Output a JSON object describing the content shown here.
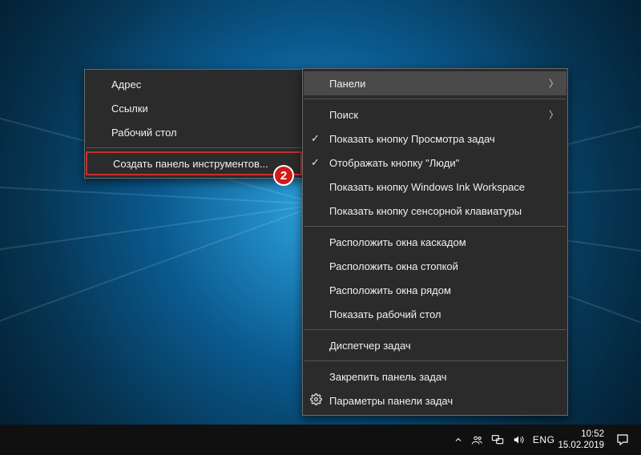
{
  "main_menu": {
    "items": {
      "toolbars": "Панели",
      "search": "Поиск",
      "show_task_view": "Показать кнопку Просмотра задач",
      "show_people": "Отображать кнопку \"Люди\"",
      "show_ink": "Показать кнопку Windows Ink Workspace",
      "show_touch_kb": "Показать кнопку сенсорной клавиатуры",
      "cascade": "Расположить окна каскадом",
      "stacked": "Расположить окна стопкой",
      "side_by_side": "Расположить окна рядом",
      "show_desktop": "Показать рабочий стол",
      "task_manager": "Диспетчер задач",
      "lock_taskbar": "Закрепить панель задач",
      "taskbar_settings": "Параметры панели задач"
    }
  },
  "sub_menu": {
    "items": {
      "address": "Адрес",
      "links": "Ссылки",
      "desktop": "Рабочий стол",
      "new_toolbar": "Создать панель инструментов..."
    }
  },
  "annotation": {
    "badge2": "2"
  },
  "taskbar": {
    "lang": "ENG",
    "time": "10:52",
    "date": "15.02.2019"
  }
}
